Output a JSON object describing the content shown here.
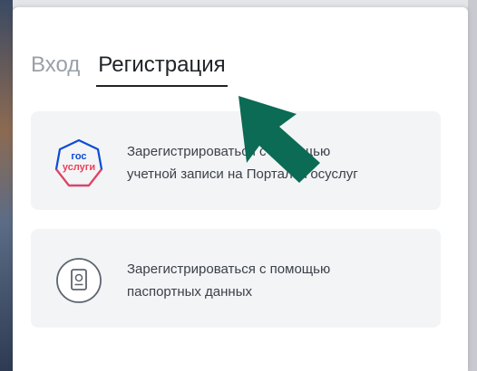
{
  "tabs": {
    "login": "Вход",
    "register": "Регистрация"
  },
  "options": [
    {
      "line1": "Зарегистрироваться с помощью",
      "line2": "учетной записи на Портале Госуслуг",
      "icon": "gosuslugi-logo",
      "logo_text_top": "гос",
      "logo_text_bottom": "услуги"
    },
    {
      "line1": "Зарегистрироваться с помощью",
      "line2": "паспортных данных",
      "icon": "passport-icon"
    }
  ],
  "colors": {
    "logo_blue": "#0d4cd3",
    "logo_red": "#ee3f58",
    "arrow": "#0b6b55",
    "card_bg": "#f3f4f6"
  }
}
